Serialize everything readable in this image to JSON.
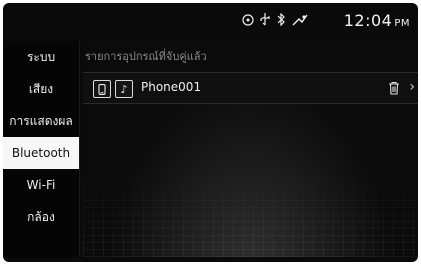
{
  "status": {
    "time": "12:04",
    "ampm": "PM",
    "icons": [
      "disc-icon",
      "usb-icon",
      "bluetooth-icon",
      "gps-icon"
    ]
  },
  "sidebar": {
    "items": [
      {
        "label": "ระบบ",
        "active": false
      },
      {
        "label": "เสียง",
        "active": false
      },
      {
        "label": "การแสดงผล",
        "active": false
      },
      {
        "label": "Bluetooth",
        "active": true
      },
      {
        "label": "Wi-Fi",
        "active": false
      },
      {
        "label": "กล้อง",
        "active": false
      }
    ]
  },
  "main": {
    "section_title": "รายการอุปกรณ์ที่จับคู่แล้ว",
    "devices": [
      {
        "name": "Phone001",
        "icons": [
          "phone-icon",
          "music-icon"
        ]
      }
    ]
  }
}
